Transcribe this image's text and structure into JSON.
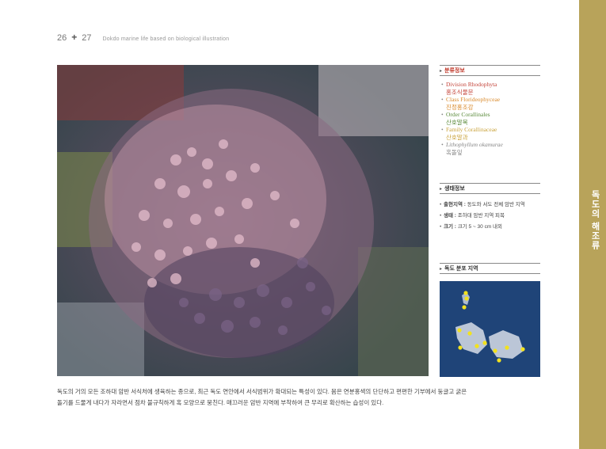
{
  "header": {
    "page_left": "26",
    "separator": "+",
    "page_right": "27",
    "running_title": "Dokdo marine life based on biological illustration"
  },
  "side_tab": {
    "label": "독도의 해조류",
    "color": "#b8a35a"
  },
  "photo": {
    "alt": "Lithophyllum okamurae coralline algae photograph"
  },
  "taxonomy": {
    "title": "분류정보",
    "items": [
      {
        "latin": "Division Rhodophyta",
        "korean": "홍조식물문",
        "color": "#c4453b"
      },
      {
        "latin": "Class Florideophyceae",
        "korean": "진정홍조강",
        "color": "#d9892a"
      },
      {
        "latin": "Order Corallinales",
        "korean": "산호말목",
        "color": "#5a8a3a"
      },
      {
        "latin": "Family Corallinaceae",
        "korean": "산호말과",
        "color": "#c9a23a"
      },
      {
        "latin": "Lithophyllum okamurae",
        "korean": "혹돌잎",
        "color": "#888888"
      }
    ]
  },
  "ecology": {
    "title": "생태정보",
    "items": [
      {
        "label": "출현지역 :",
        "value": "동도와 서도 전체 암반 지역"
      },
      {
        "label": "생태 :",
        "value": "조하대 암반 지역 피복"
      },
      {
        "label": "크기 :",
        "value": "크기 5 ~ 30 cm 내외"
      }
    ]
  },
  "distribution": {
    "title": "독도 분포 지역"
  },
  "description": {
    "line1": "독도의 거의 모든 조하대 암반 서식처에 생육하는 종으로, 최근 독도 연안에서 서식범위가 확대되는 특성이 있다. 몸은 연분홍색의 단단하고 편편한 기부에서 둥글고 굵은",
    "line2": "돌기를 드물게 내다가 자라면서 점차 불규칙하게 혹 모양으로 뭉친다. 매끄러운 암반 지역에 부착하여 큰 무리로 확산하는 습성이 있다."
  }
}
